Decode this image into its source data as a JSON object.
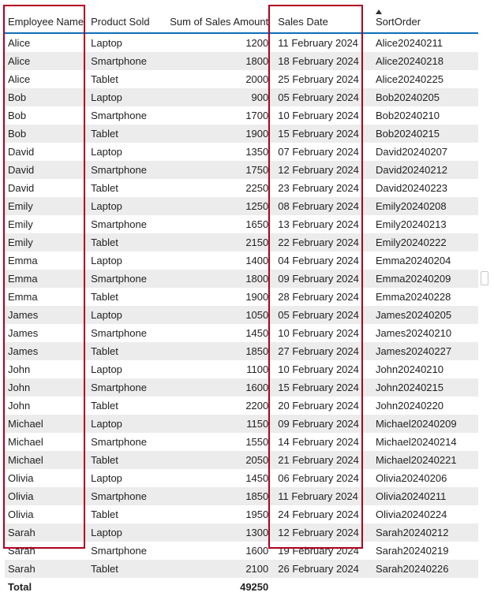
{
  "columns": {
    "employee": "Employee Name",
    "product": "Product Sold",
    "amount": "Sum of Sales Amount",
    "date": "Sales Date",
    "sort": "SortOrder"
  },
  "rows": [
    {
      "employee": "Alice",
      "product": "Laptop",
      "amount": 1200,
      "date": "11 February 2024",
      "sort": "Alice20240211"
    },
    {
      "employee": "Alice",
      "product": "Smartphone",
      "amount": 1800,
      "date": "18 February 2024",
      "sort": "Alice20240218"
    },
    {
      "employee": "Alice",
      "product": "Tablet",
      "amount": 2000,
      "date": "25 February 2024",
      "sort": "Alice20240225"
    },
    {
      "employee": "Bob",
      "product": "Laptop",
      "amount": 900,
      "date": "05 February 2024",
      "sort": "Bob20240205"
    },
    {
      "employee": "Bob",
      "product": "Smartphone",
      "amount": 1700,
      "date": "10 February 2024",
      "sort": "Bob20240210"
    },
    {
      "employee": "Bob",
      "product": "Tablet",
      "amount": 1900,
      "date": "15 February 2024",
      "sort": "Bob20240215"
    },
    {
      "employee": "David",
      "product": "Laptop",
      "amount": 1350,
      "date": "07 February 2024",
      "sort": "David20240207"
    },
    {
      "employee": "David",
      "product": "Smartphone",
      "amount": 1750,
      "date": "12 February 2024",
      "sort": "David20240212"
    },
    {
      "employee": "David",
      "product": "Tablet",
      "amount": 2250,
      "date": "23 February 2024",
      "sort": "David20240223"
    },
    {
      "employee": "Emily",
      "product": "Laptop",
      "amount": 1250,
      "date": "08 February 2024",
      "sort": "Emily20240208"
    },
    {
      "employee": "Emily",
      "product": "Smartphone",
      "amount": 1650,
      "date": "13 February 2024",
      "sort": "Emily20240213"
    },
    {
      "employee": "Emily",
      "product": "Tablet",
      "amount": 2150,
      "date": "22 February 2024",
      "sort": "Emily20240222"
    },
    {
      "employee": "Emma",
      "product": "Laptop",
      "amount": 1400,
      "date": "04 February 2024",
      "sort": "Emma20240204"
    },
    {
      "employee": "Emma",
      "product": "Smartphone",
      "amount": 1800,
      "date": "09 February 2024",
      "sort": "Emma20240209"
    },
    {
      "employee": "Emma",
      "product": "Tablet",
      "amount": 1900,
      "date": "28 February 2024",
      "sort": "Emma20240228"
    },
    {
      "employee": "James",
      "product": "Laptop",
      "amount": 1050,
      "date": "05 February 2024",
      "sort": "James20240205"
    },
    {
      "employee": "James",
      "product": "Smartphone",
      "amount": 1450,
      "date": "10 February 2024",
      "sort": "James20240210"
    },
    {
      "employee": "James",
      "product": "Tablet",
      "amount": 1850,
      "date": "27 February 2024",
      "sort": "James20240227"
    },
    {
      "employee": "John",
      "product": "Laptop",
      "amount": 1100,
      "date": "10 February 2024",
      "sort": "John20240210"
    },
    {
      "employee": "John",
      "product": "Smartphone",
      "amount": 1600,
      "date": "15 February 2024",
      "sort": "John20240215"
    },
    {
      "employee": "John",
      "product": "Tablet",
      "amount": 2200,
      "date": "20 February 2024",
      "sort": "John20240220"
    },
    {
      "employee": "Michael",
      "product": "Laptop",
      "amount": 1150,
      "date": "09 February 2024",
      "sort": "Michael20240209"
    },
    {
      "employee": "Michael",
      "product": "Smartphone",
      "amount": 1550,
      "date": "14 February 2024",
      "sort": "Michael20240214"
    },
    {
      "employee": "Michael",
      "product": "Tablet",
      "amount": 2050,
      "date": "21 February 2024",
      "sort": "Michael20240221"
    },
    {
      "employee": "Olivia",
      "product": "Laptop",
      "amount": 1450,
      "date": "06 February 2024",
      "sort": "Olivia20240206"
    },
    {
      "employee": "Olivia",
      "product": "Smartphone",
      "amount": 1850,
      "date": "11 February 2024",
      "sort": "Olivia20240211"
    },
    {
      "employee": "Olivia",
      "product": "Tablet",
      "amount": 1950,
      "date": "24 February 2024",
      "sort": "Olivia20240224"
    },
    {
      "employee": "Sarah",
      "product": "Laptop",
      "amount": 1300,
      "date": "12 February 2024",
      "sort": "Sarah20240212"
    },
    {
      "employee": "Sarah",
      "product": "Smartphone",
      "amount": 1600,
      "date": "19 February 2024",
      "sort": "Sarah20240219"
    },
    {
      "employee": "Sarah",
      "product": "Tablet",
      "amount": 2100,
      "date": "26 February 2024",
      "sort": "Sarah20240226"
    }
  ],
  "totals": {
    "label": "Total",
    "amount": 49250
  },
  "highlight_color": "#b00020"
}
